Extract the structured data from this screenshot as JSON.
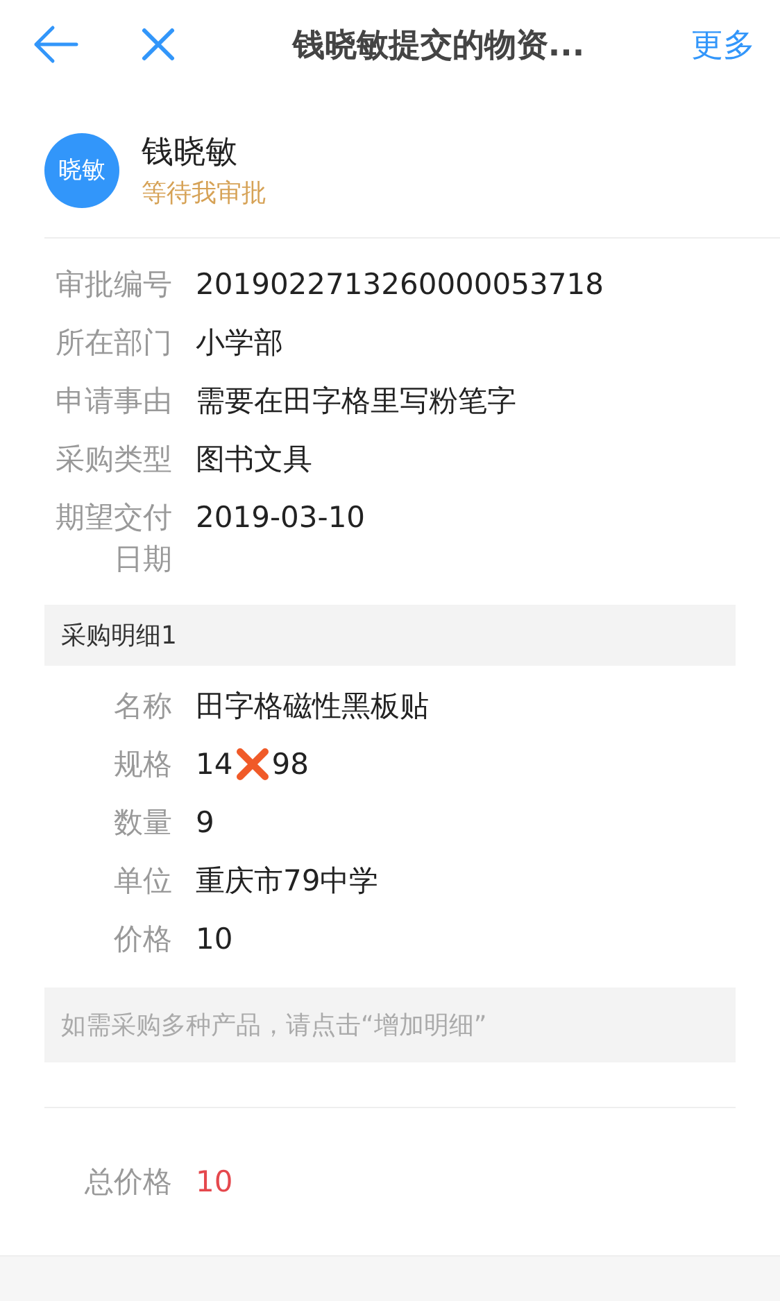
{
  "header": {
    "title": "钱晓敏提交的物资...",
    "more": "更多"
  },
  "applicant": {
    "avatar": "晓敏",
    "name": "钱晓敏",
    "status": "等待我审批"
  },
  "fields": [
    {
      "label": "审批编号",
      "value": "2019022713260000053718"
    },
    {
      "label": "所在部门",
      "value": "小学部"
    },
    {
      "label": "申请事由",
      "value": "需要在田字格里写粉笔字"
    },
    {
      "label": "采购类型",
      "value": "图书文具"
    },
    {
      "label": "期望交付日期",
      "value": "2019-03-10"
    }
  ],
  "detail": {
    "title": "采购明细1",
    "items": [
      {
        "label": "名称",
        "value_parts": [
          "田字格磁性黑板贴"
        ]
      },
      {
        "label": "规格",
        "value_parts": [
          "14",
          "98"
        ]
      },
      {
        "label": "数量",
        "value_parts": [
          "9"
        ]
      },
      {
        "label": "单位",
        "value_parts": [
          "重庆市79中学"
        ]
      },
      {
        "label": "价格",
        "value_parts": [
          "10"
        ]
      }
    ]
  },
  "note": "如需采购多种产品，请点击“增加明细”",
  "total": {
    "label": "总价格",
    "value": "10"
  }
}
